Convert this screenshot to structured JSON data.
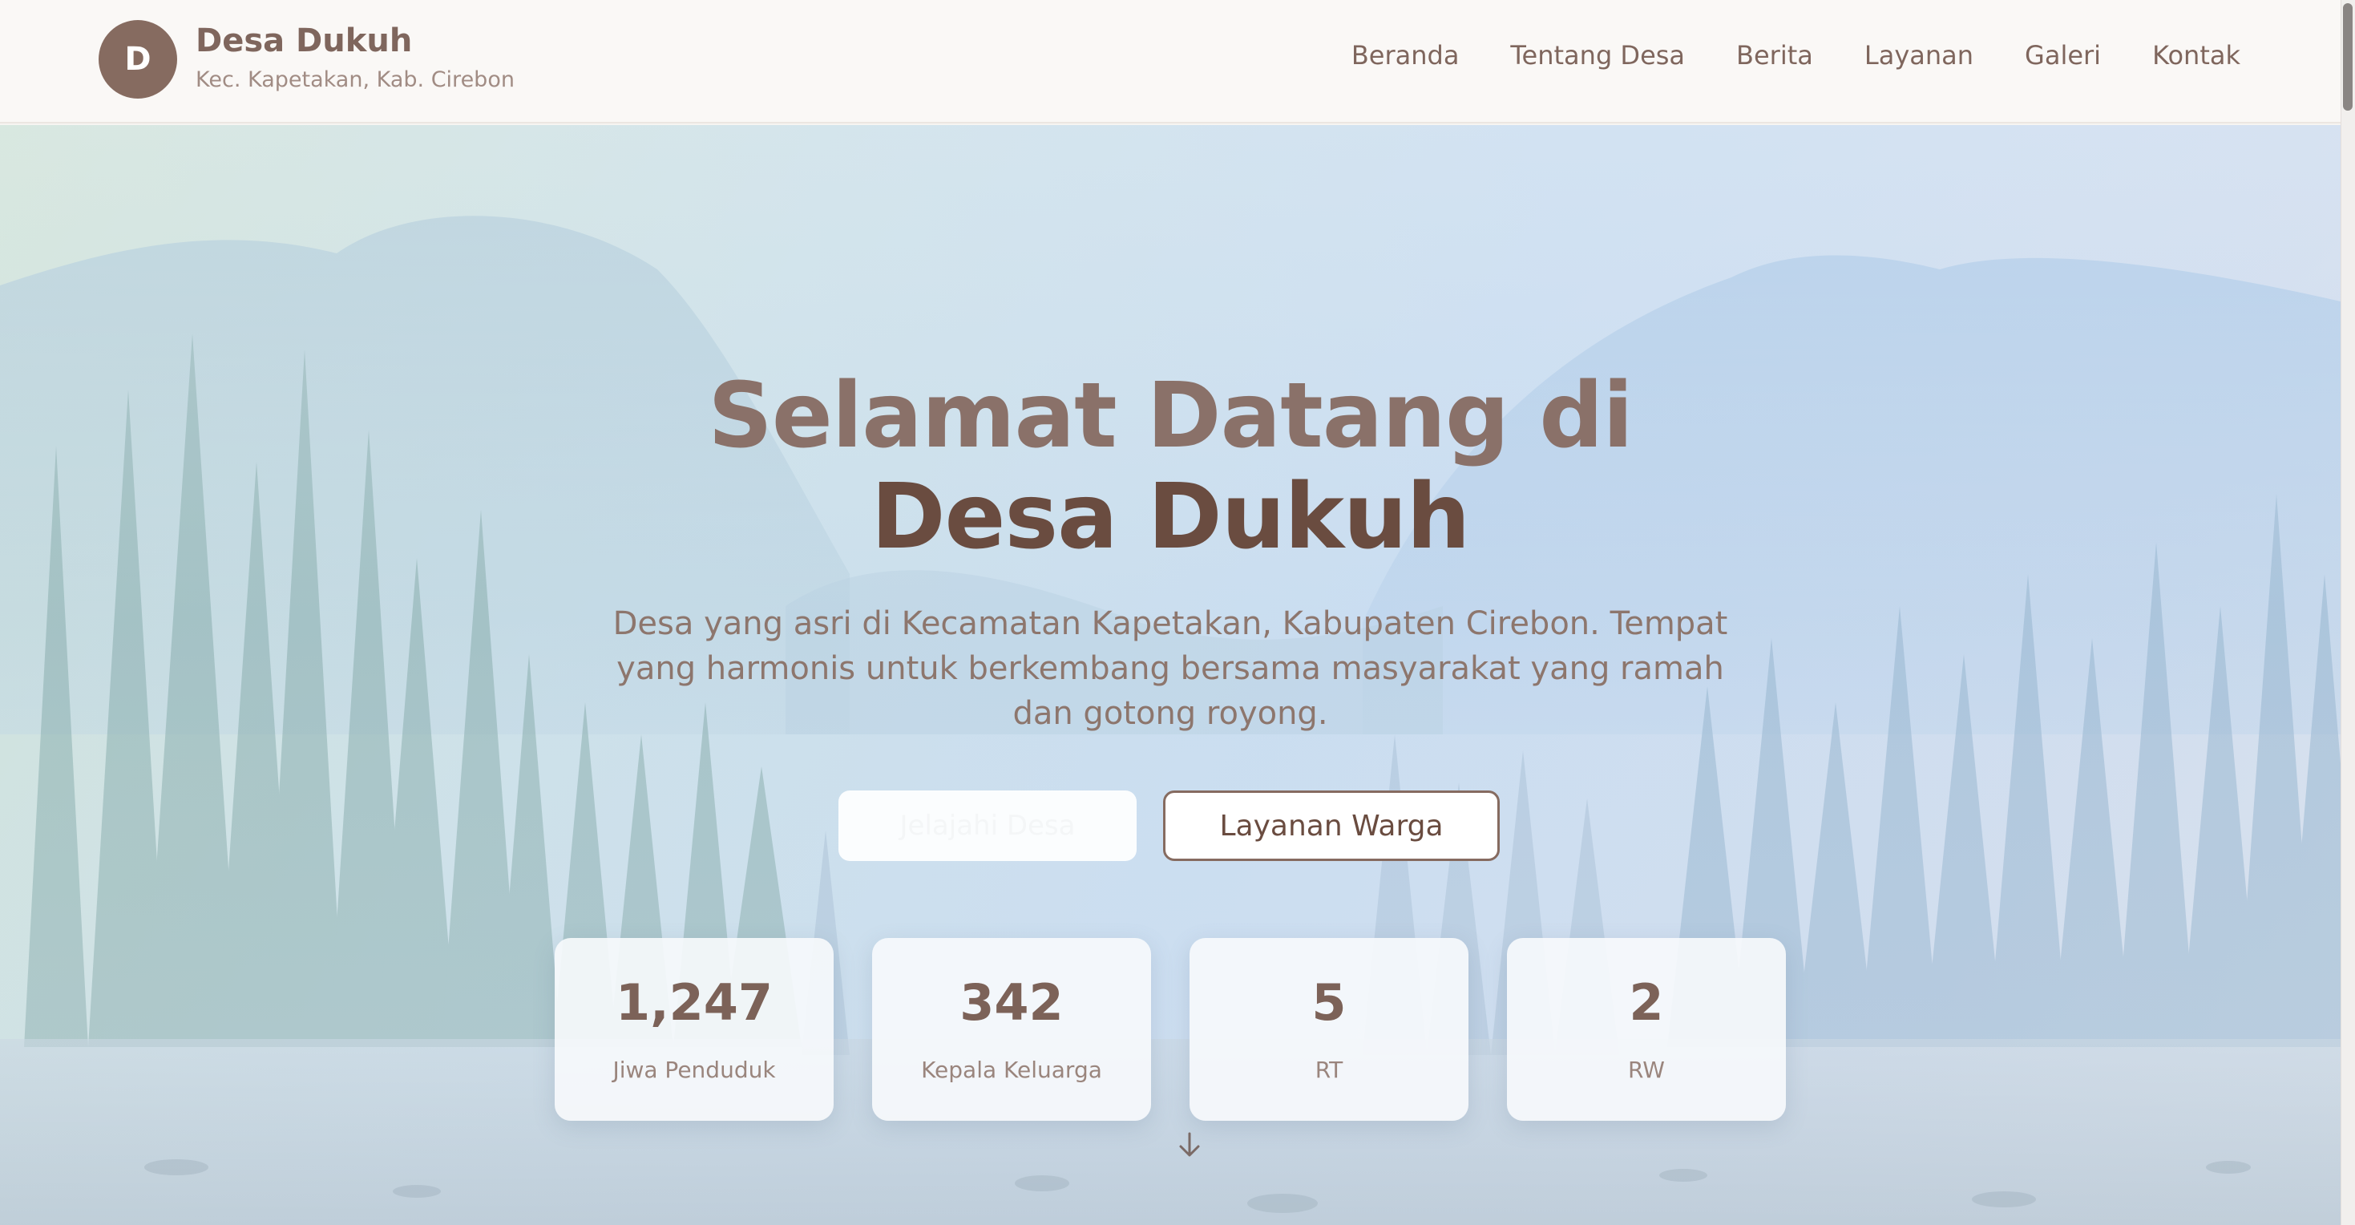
{
  "header": {
    "logo_letter": "D",
    "brand_name": "Desa Dukuh",
    "brand_sub": "Kec. Kapetakan, Kab. Cirebon",
    "nav": [
      {
        "label": "Beranda"
      },
      {
        "label": "Tentang Desa"
      },
      {
        "label": "Berita"
      },
      {
        "label": "Layanan"
      },
      {
        "label": "Galeri"
      },
      {
        "label": "Kontak"
      }
    ]
  },
  "hero": {
    "title_line1": "Selamat Datang di",
    "title_line2": "Desa Dukuh",
    "description": "Desa yang asri di Kecamatan Kapetakan, Kabupaten Cirebon. Tempat yang harmonis untuk berkembang bersama masyarakat yang ramah dan gotong royong.",
    "primary_button": "Jelajahi Desa",
    "secondary_button": "Layanan Warga",
    "stats": [
      {
        "value": "1,247",
        "label": "Jiwa Penduduk"
      },
      {
        "value": "342",
        "label": "Kepala Keluarga"
      },
      {
        "value": "5",
        "label": "RT"
      },
      {
        "value": "2",
        "label": "RW"
      }
    ]
  },
  "colors": {
    "brand": "#866b60",
    "brand_dark": "#6a4c40",
    "header_bg": "#faf8f6"
  },
  "icons": {
    "scroll_down": "arrow-down-icon"
  }
}
